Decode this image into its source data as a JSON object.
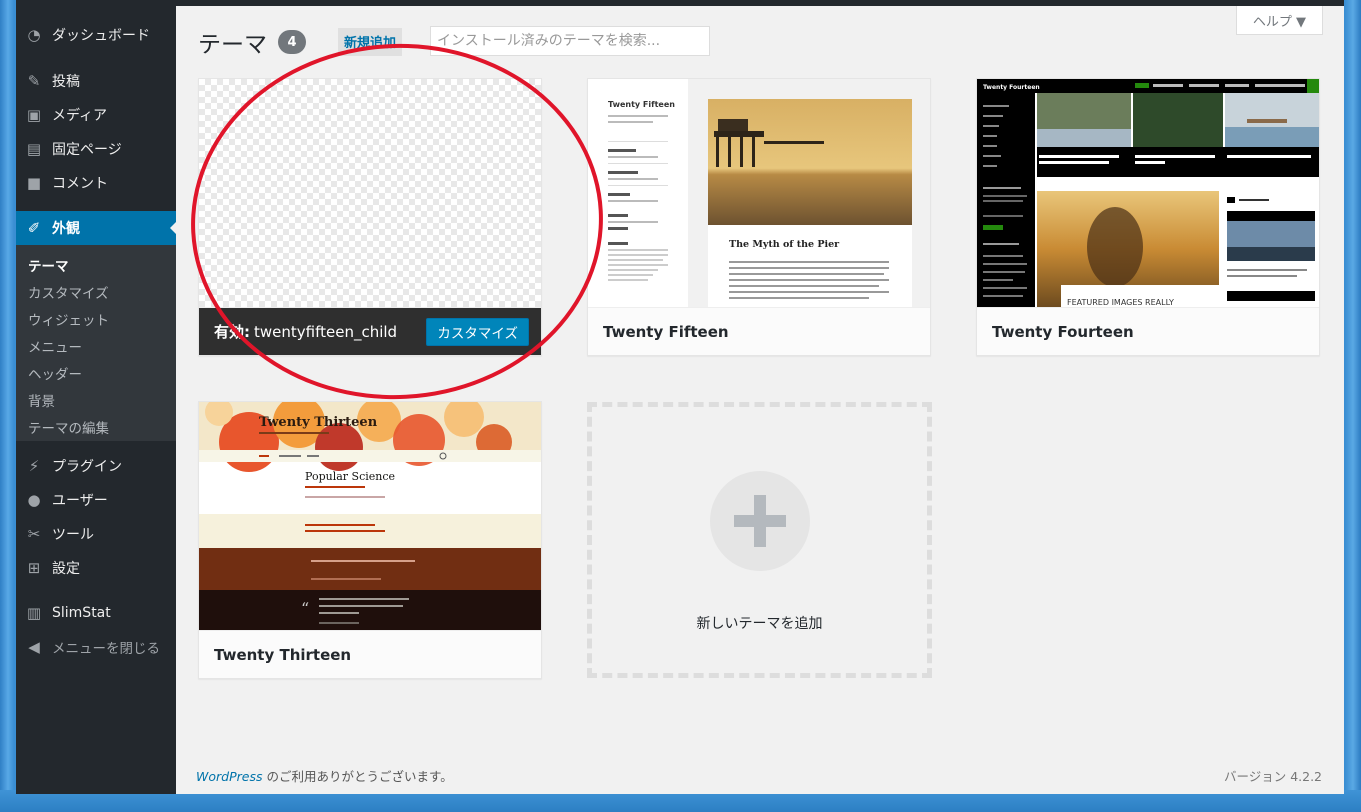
{
  "sidebar": {
    "items": [
      {
        "label": "ダッシュボード",
        "icon": "dashboard-icon"
      },
      {
        "label": "投稿",
        "icon": "pin-icon"
      },
      {
        "label": "メディア",
        "icon": "media-icon"
      },
      {
        "label": "固定ページ",
        "icon": "page-icon"
      },
      {
        "label": "コメント",
        "icon": "comment-icon"
      },
      {
        "label": "外観",
        "icon": "brush-icon"
      },
      {
        "label": "プラグイン",
        "icon": "plugin-icon"
      },
      {
        "label": "ユーザー",
        "icon": "user-icon"
      },
      {
        "label": "ツール",
        "icon": "wrench-icon"
      },
      {
        "label": "設定",
        "icon": "settings-icon"
      },
      {
        "label": "SlimStat",
        "icon": "chart-icon"
      },
      {
        "label": "メニューを閉じる",
        "icon": "collapse-icon"
      }
    ],
    "submenu": [
      "テーマ",
      "カスタマイズ",
      "ウィジェット",
      "メニュー",
      "ヘッダー",
      "背景",
      "テーマの編集"
    ]
  },
  "header": {
    "title": "テーマ",
    "count": "4",
    "add_new": "新規追加",
    "search_placeholder": "インストール済みのテーマを検索...",
    "help": "ヘルプ ▼"
  },
  "themes": {
    "active_prefix": "有効:",
    "active_name": "twentyfifteen_child",
    "customize": "カスタマイズ",
    "t2": "Twenty Fifteen",
    "t3": "Twenty Fourteen",
    "t4": "Twenty Thirteen",
    "add_new": "新しいテーマを追加"
  },
  "preview": {
    "fifteen_site": "Twenty Fifteen",
    "fifteen_post": "The Myth of the Pier",
    "fourteen_site": "Twenty Fourteen",
    "fourteen_feature": "FEATURED IMAGES REALLY",
    "thirteen_site": "Twenty Thirteen",
    "thirteen_post": "Popular Science"
  },
  "footer": {
    "wp": "WordPress",
    "thanks": " のご利用ありがとうございます。",
    "version": "バージョン 4.2.2"
  },
  "colors": {
    "accent": "#0073aa",
    "annotation": "#e0152a",
    "sidebar": "#23282d"
  }
}
